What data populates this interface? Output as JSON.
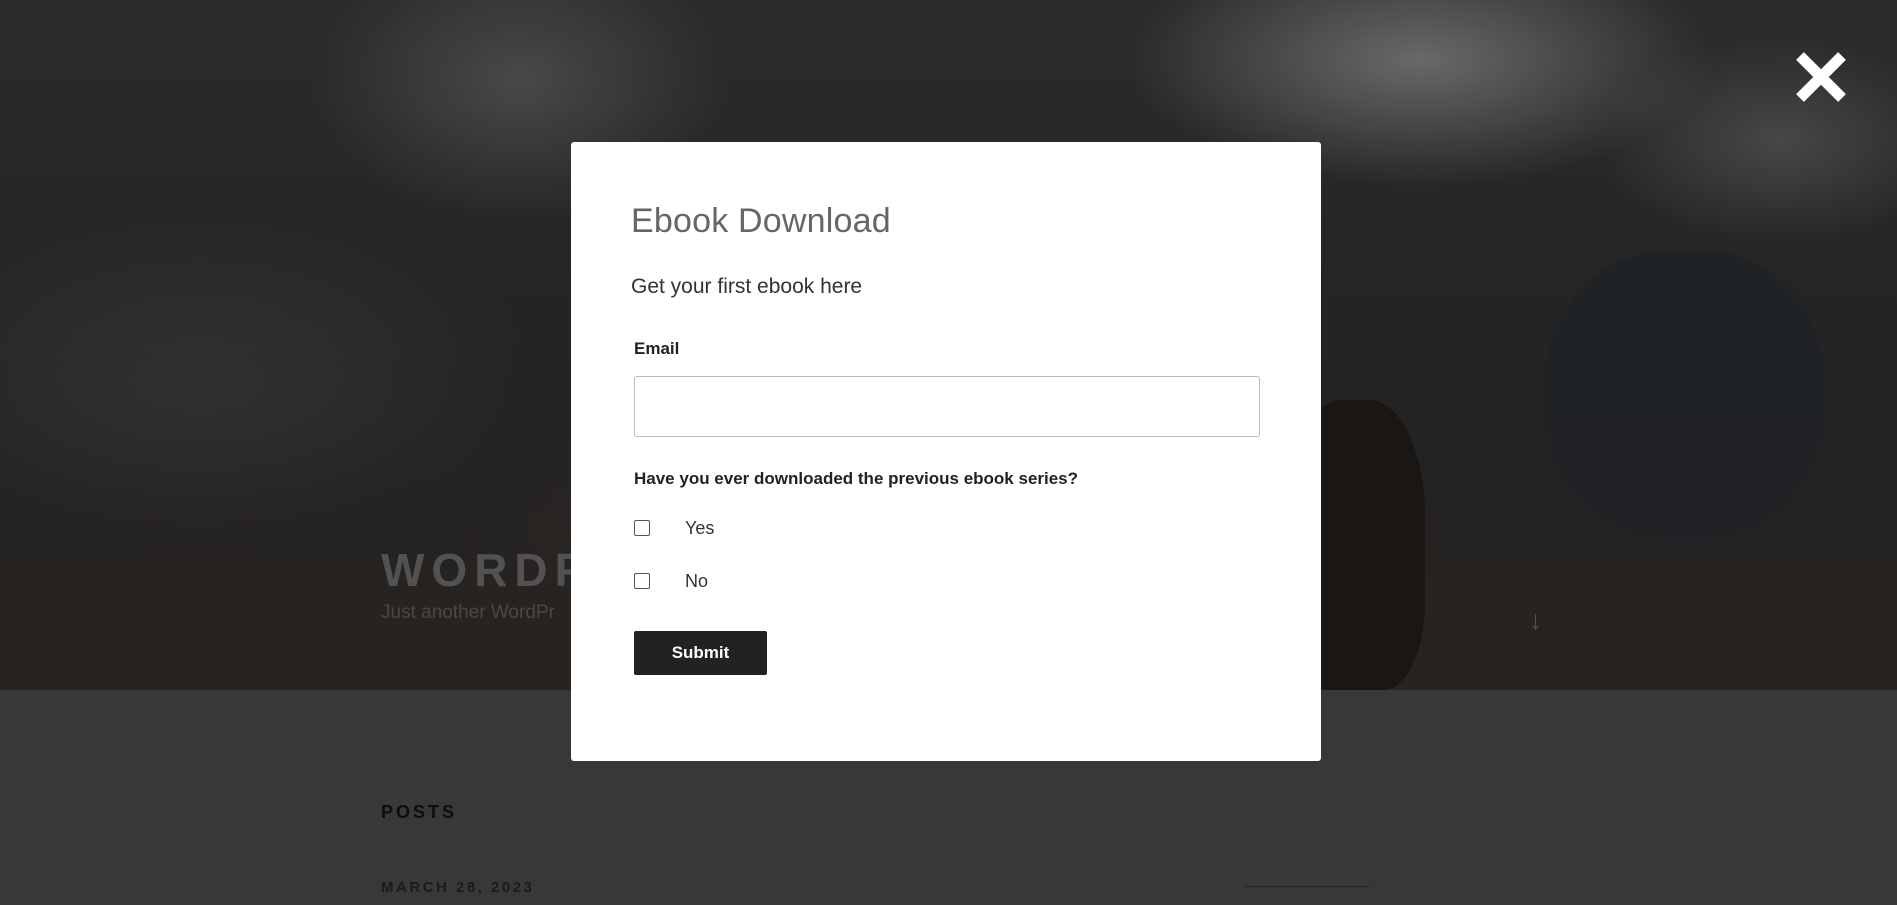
{
  "background_page": {
    "site_title": "WORDP",
    "site_tagline": "Just another WordPr",
    "scroll_icon": "arrow-down-icon",
    "posts_heading": "POSTS",
    "post_date": "MARCH 28, 2023"
  },
  "modal": {
    "close_icon": "close-icon",
    "title": "Ebook Download",
    "subtitle": "Get your first ebook here",
    "email_label": "Email",
    "email_value": "",
    "email_placeholder": "",
    "question_label": "Have you ever downloaded the previous ebook series?",
    "options": [
      {
        "label": "Yes",
        "checked": false
      },
      {
        "label": "No",
        "checked": false
      }
    ],
    "submit_label": "Submit"
  },
  "colors": {
    "modal_background": "#ffffff",
    "button_background": "#222222",
    "button_text": "#ffffff",
    "title_color": "#666666",
    "overlay": "#3d3d3d"
  }
}
